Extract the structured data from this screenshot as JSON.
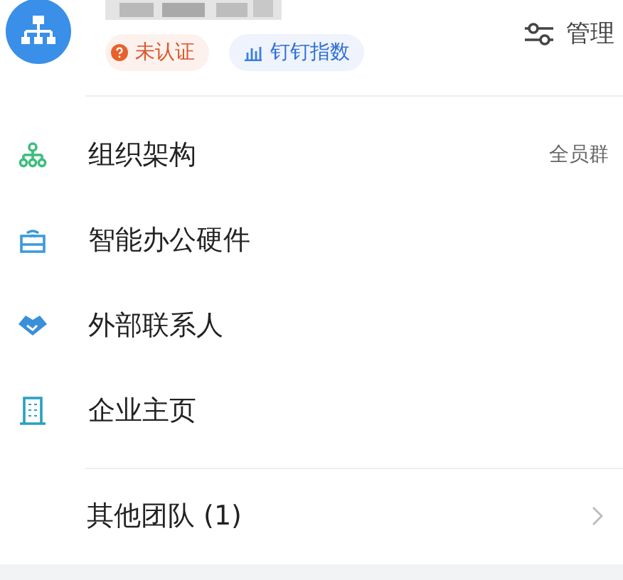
{
  "header": {
    "badges": [
      {
        "kind": "unverified",
        "label": "未认证"
      },
      {
        "kind": "index",
        "label": "钉钉指数"
      }
    ],
    "manage": {
      "label": "管理"
    }
  },
  "menu": [
    {
      "kind": "org",
      "label": "组织架构",
      "extra": "全员群"
    },
    {
      "kind": "hardware",
      "label": "智能办公硬件"
    },
    {
      "kind": "contacts",
      "label": "外部联系人"
    },
    {
      "kind": "homepage",
      "label": "企业主页"
    }
  ],
  "other_teams": {
    "label": "其他团队 (1)"
  }
}
